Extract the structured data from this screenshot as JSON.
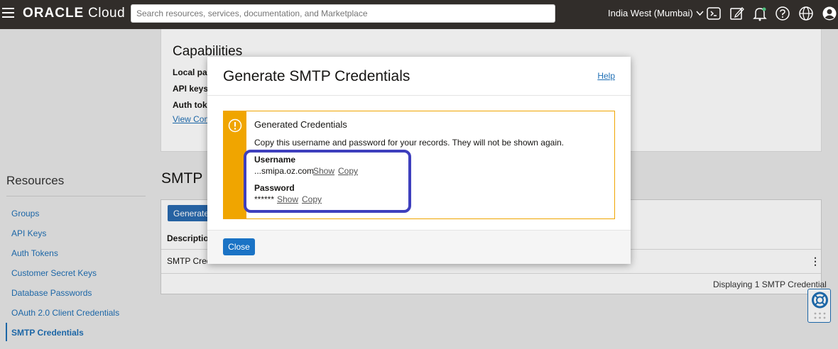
{
  "header": {
    "brand_main": "ORACLE",
    "brand_sub": "Cloud",
    "search_placeholder": "Search resources, services, documentation, and Marketplace",
    "region": "India West (Mumbai)"
  },
  "capabilities": {
    "title": "Capabilities",
    "labels": [
      "Local pas",
      "API keys:",
      "Auth toke"
    ],
    "link": "View Conf"
  },
  "resources": {
    "title": "Resources",
    "items": [
      {
        "label": "Groups"
      },
      {
        "label": "API Keys"
      },
      {
        "label": "Auth Tokens"
      },
      {
        "label": "Customer Secret Keys"
      },
      {
        "label": "Database Passwords"
      },
      {
        "label": "OAuth 2.0 Client Credentials"
      },
      {
        "label": "SMTP Credentials"
      }
    ],
    "active_index": 6
  },
  "smtp_section": {
    "title": "SMTP",
    "generate_button": "Generate",
    "column_description": "Descriptio",
    "row_description": "SMTP Cred",
    "footer": "Displaying 1 SMTP Credential"
  },
  "modal": {
    "title": "Generate SMTP Credentials",
    "help": "Help",
    "alert_title": "Generated Credentials",
    "alert_text": "Copy this username and password for your records. They will not be shown again.",
    "username_label": "Username",
    "username_value": "...smipa.oz.com",
    "password_label": "Password",
    "password_value": "******",
    "show": "Show",
    "copy": "Copy",
    "close_button": "Close"
  },
  "colors": {
    "topbar": "#312d2a",
    "warning": "#f0a500",
    "highlight": "#3e3fbd",
    "primary": "#1a73c5"
  }
}
